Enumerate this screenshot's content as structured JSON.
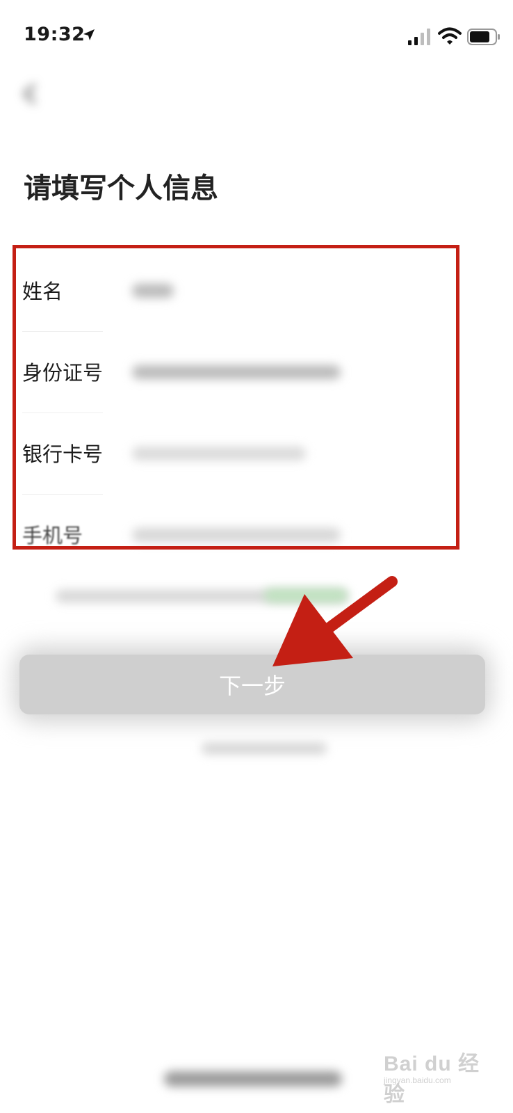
{
  "status_bar": {
    "time": "19:32"
  },
  "page_title": "请填写个人信息",
  "form_rows": [
    {
      "label": "姓名"
    },
    {
      "label": "身份证号"
    },
    {
      "label": "银行卡号"
    },
    {
      "label": "手机号"
    }
  ],
  "next_button": {
    "label": "下一步"
  },
  "watermark": {
    "brand": "Bai du 经验",
    "domain": "jingyan.baidu.com"
  },
  "colors": {
    "highlight": "#c41f14",
    "button_bg": "#cfcfcf"
  }
}
